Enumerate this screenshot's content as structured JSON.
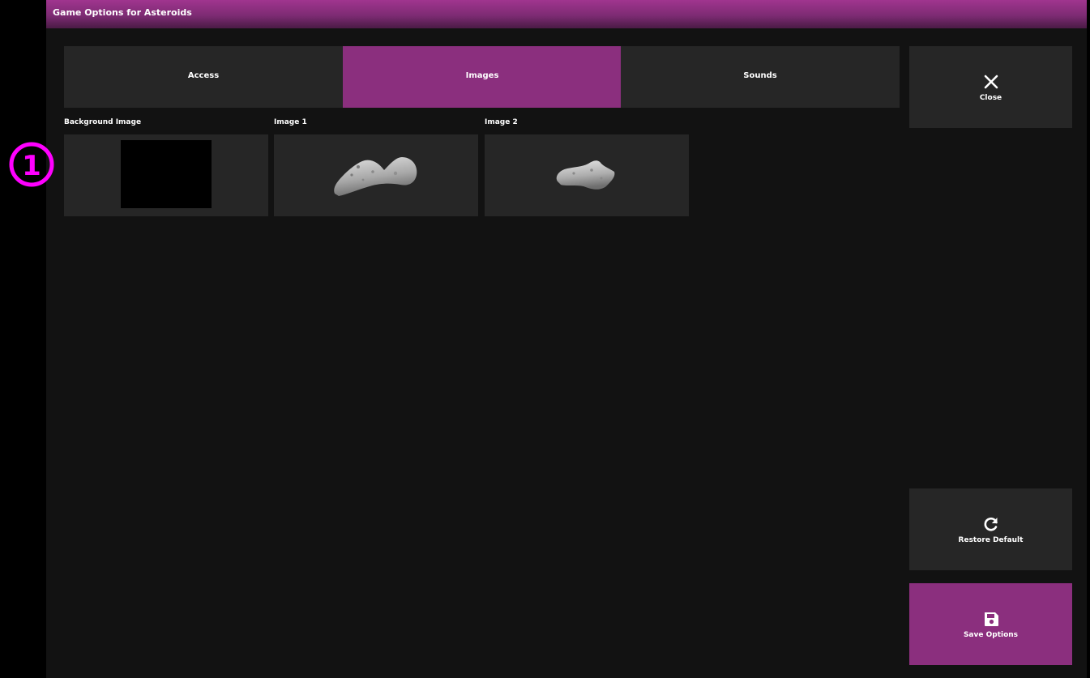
{
  "window": {
    "title": "Game Options for Asteroids"
  },
  "tabs": [
    {
      "label": "Access",
      "active": false
    },
    {
      "label": "Images",
      "active": true
    },
    {
      "label": "Sounds",
      "active": false
    }
  ],
  "images": [
    {
      "label": "Background Image",
      "preview": "black-image"
    },
    {
      "label": "Image 1",
      "preview": "asteroid-image"
    },
    {
      "label": "Image 2",
      "preview": "asteroid-image"
    }
  ],
  "buttons": {
    "close": {
      "label": "Close",
      "icon": "close-icon"
    },
    "restore": {
      "label": "Restore Default",
      "icon": "refresh-icon"
    },
    "save": {
      "label": "Save Options",
      "icon": "floppy-disk-icon"
    }
  },
  "annotation": {
    "number": "1",
    "color": "#ff00ff"
  },
  "colors": {
    "accent": "#8b2f7e",
    "panel": "#262626",
    "background": "#121212"
  }
}
